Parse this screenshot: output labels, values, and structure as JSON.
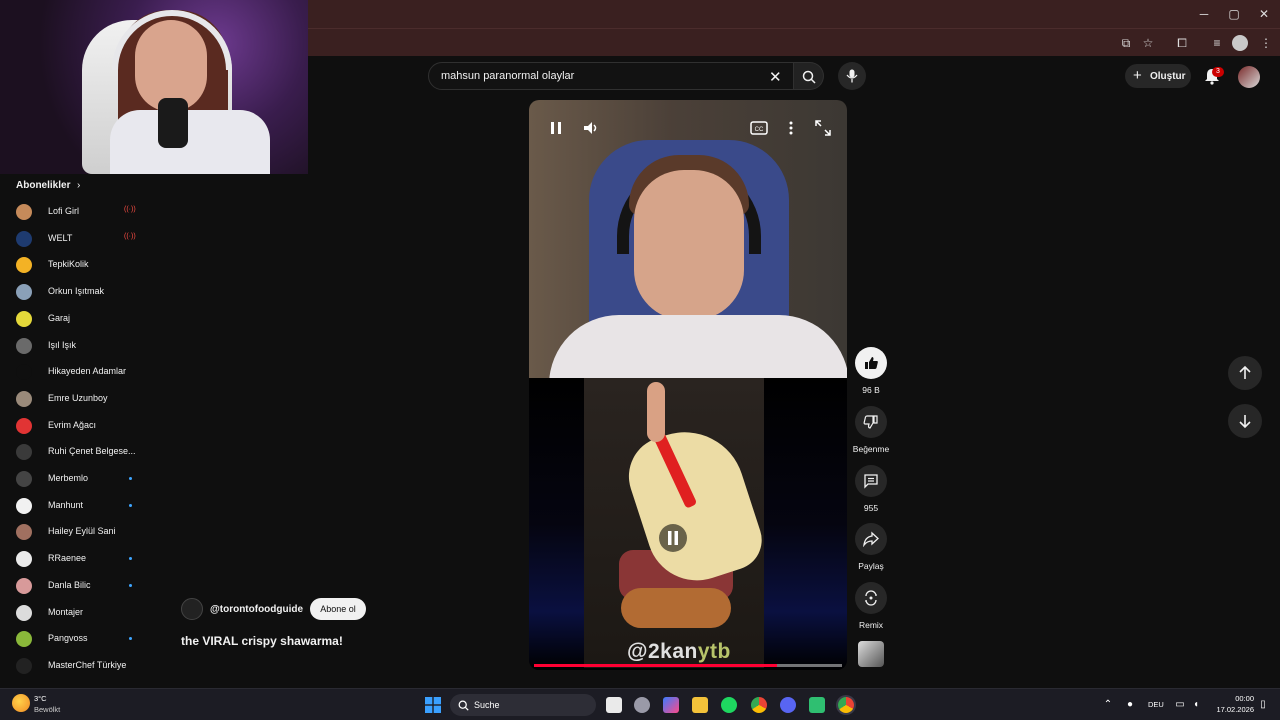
{
  "browser": {
    "window_controls": [
      "─",
      "▢",
      "✕"
    ]
  },
  "search": {
    "query": "mahsun paranormal olaylar"
  },
  "header": {
    "create_label": "Oluştur",
    "notification_count": "3"
  },
  "sidebar": {
    "section_title": "Abonelikler",
    "subscriptions": [
      {
        "name": "Lofi Girl",
        "indicator": "live",
        "avatar_color": "#c58a5a"
      },
      {
        "name": "WELT",
        "indicator": "live",
        "avatar_color": "#1e3b70"
      },
      {
        "name": "TepkiKolik",
        "indicator": "",
        "avatar_color": "#f3b225"
      },
      {
        "name": "Orkun Işıtmak",
        "indicator": "",
        "avatar_color": "#8aa0b8"
      },
      {
        "name": "Garaj",
        "indicator": "",
        "avatar_color": "#e4d83a"
      },
      {
        "name": "Işıl Işık",
        "indicator": "",
        "avatar_color": "#6a6a6a"
      },
      {
        "name": "Hikayeden Adamlar",
        "indicator": "",
        "avatar_color": "#0f0f0f"
      },
      {
        "name": "Emre Uzunboy",
        "indicator": "",
        "avatar_color": "#9a8a7a"
      },
      {
        "name": "Evrim Ağacı",
        "indicator": "",
        "avatar_color": "#e13434"
      },
      {
        "name": "Ruhi Çenet Belgese...",
        "indicator": "",
        "avatar_color": "#3a3a3a"
      },
      {
        "name": "Merbemlo",
        "indicator": "new",
        "avatar_color": "#444"
      },
      {
        "name": "Manhunt",
        "indicator": "new",
        "avatar_color": "#f1f1f1"
      },
      {
        "name": "Hailey Eylül Sani",
        "indicator": "",
        "avatar_color": "#a07060"
      },
      {
        "name": "RRaenee",
        "indicator": "new",
        "avatar_color": "#eaeaea"
      },
      {
        "name": "Danla Bilic",
        "indicator": "new",
        "avatar_color": "#d89a9a"
      },
      {
        "name": "Montajer",
        "indicator": "",
        "avatar_color": "#dcdcdc"
      },
      {
        "name": "Pangvoss",
        "indicator": "new",
        "avatar_color": "#8ab83a"
      },
      {
        "name": "MasterChef Türkiye",
        "indicator": "",
        "avatar_color": "#222"
      }
    ]
  },
  "video": {
    "overlay_handle_prefix": "@2kan",
    "overlay_handle_suffix": "ytb",
    "progress": 0.79,
    "channel": "@torontofoodguide",
    "subscribe_label": "Abone ol",
    "title": "the VIRAL crispy shawarma!"
  },
  "actions": {
    "like_count": "96 B",
    "dislike_label": "Beğenme",
    "comment_count": "955",
    "share_label": "Paylaş",
    "remix_label": "Remix"
  },
  "taskbar": {
    "weather_temp": "3°C",
    "weather_desc": "Bewölkt",
    "search_label": "Suche",
    "language": "DEU",
    "time": "00:00",
    "date": "17.02.2026"
  },
  "colors": {
    "background": "#0f0f0f",
    "accent_red": "#ff0033",
    "browser_frame": "#3a2020"
  }
}
